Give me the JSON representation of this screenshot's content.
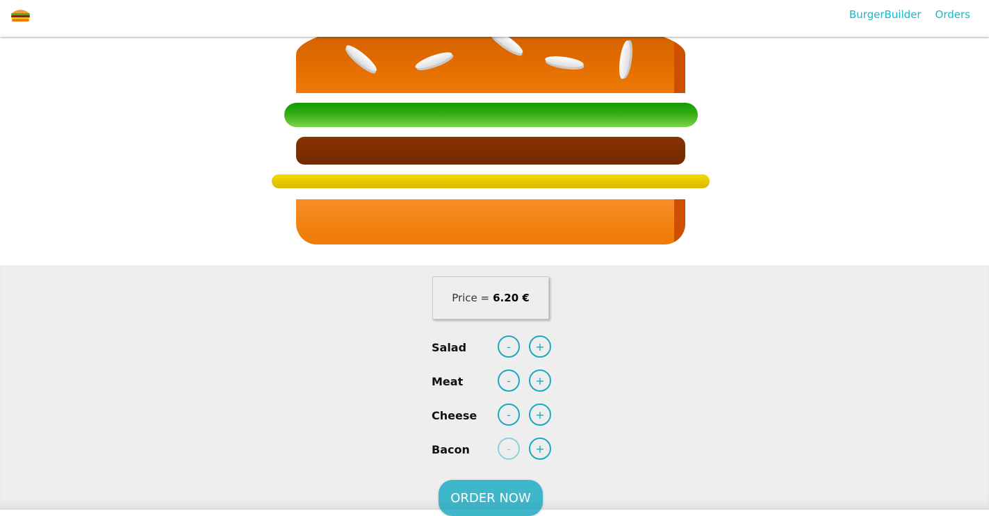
{
  "toolbar": {
    "logo": "burger-logo-icon",
    "nav": [
      {
        "label": "BurgerBuilder"
      },
      {
        "label": "Orders"
      }
    ]
  },
  "burger": {
    "ingredients": [
      "bread-top",
      "salad",
      "meat",
      "cheese",
      "bread-bottom"
    ]
  },
  "controls": {
    "price_label": "Price =",
    "price_value": "6.20 €",
    "items": [
      {
        "label": "Salad",
        "less": "-",
        "more": "+"
      },
      {
        "label": "Meat",
        "less": "-",
        "more": "+"
      },
      {
        "label": "Cheese",
        "less": "-",
        "more": "+"
      },
      {
        "label": "Bacon",
        "less": "-",
        "more": "+"
      }
    ],
    "order_label": "ORDER NOW"
  },
  "colors": {
    "accent": "#19b6cc",
    "salad": "#2ea80f",
    "meat": "#7a2e02",
    "cheese": "#e9c900",
    "bun": "#ef7a05"
  }
}
